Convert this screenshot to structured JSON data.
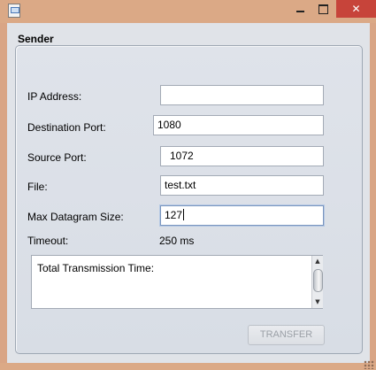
{
  "window": {
    "title": "",
    "icons": {
      "app": "java-window-icon",
      "minimize": "minimize-icon",
      "maximize": "maximize-icon",
      "close": "close-icon"
    },
    "colors": {
      "frame": "#dba986",
      "close": "#c7443a"
    }
  },
  "group": {
    "title": "Sender"
  },
  "form": {
    "ip_address": {
      "label": "IP Address:",
      "value": ""
    },
    "destination_port": {
      "label": "Destination Port:",
      "value": "1080"
    },
    "source_port": {
      "label": "Source Port:",
      "value": "1072"
    },
    "file": {
      "label": "File:",
      "value": "test.txt"
    },
    "max_datagram_size": {
      "label": "Max Datagram Size:",
      "value": "127"
    },
    "timeout": {
      "label": "Timeout:",
      "value": "250 ms"
    }
  },
  "output": {
    "text": "Total Transmission Time:"
  },
  "actions": {
    "transfer_label": "TRANSFER",
    "transfer_enabled": false
  }
}
